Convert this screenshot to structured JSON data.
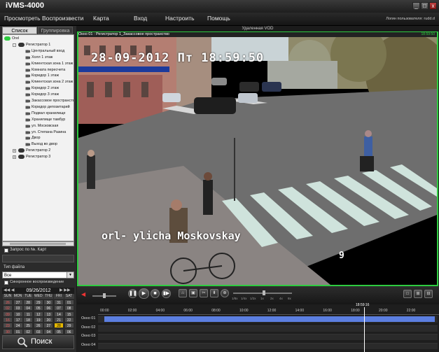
{
  "app": {
    "title": "iVMS-4000"
  },
  "window_buttons": {
    "minimize": "_",
    "maximize": "□",
    "close": "x"
  },
  "menu": [
    "Просмотреть",
    "Воспроизвести",
    "Карта",
    "Вход",
    "Настроить",
    "Помощь"
  ],
  "user_info": "Логин пользователя: rudd.d",
  "left": {
    "tabs": [
      "Список",
      "Группировка"
    ],
    "tree": [
      {
        "label": "Orel",
        "level": 0,
        "type": "root"
      },
      {
        "label": "Регистратор 1",
        "level": 1,
        "type": "node",
        "expanded": true
      },
      {
        "label": "Центральный вход",
        "level": 2,
        "type": "camera"
      },
      {
        "label": "Холл 1 этаж",
        "level": 2,
        "type": "camera"
      },
      {
        "label": "Клиентская зона 1 этаж",
        "level": 2,
        "type": "camera"
      },
      {
        "label": "Комната пересчета",
        "level": 2,
        "type": "camera"
      },
      {
        "label": "Коридор 1 этаж",
        "level": 2,
        "type": "camera"
      },
      {
        "label": "Клиентская зона 2 этаж",
        "level": 2,
        "type": "camera"
      },
      {
        "label": "Коридор 2 этаж",
        "level": 2,
        "type": "camera"
      },
      {
        "label": "Коридор 3 этаж",
        "level": 2,
        "type": "camera"
      },
      {
        "label": "Закассовое пространство",
        "level": 2,
        "type": "camera"
      },
      {
        "label": "Коридор депозитарий",
        "level": 2,
        "type": "camera"
      },
      {
        "label": "Подвал хранилище",
        "level": 2,
        "type": "camera"
      },
      {
        "label": "Хранилище тамбур",
        "level": 2,
        "type": "camera"
      },
      {
        "label": "ул. Московская",
        "level": 2,
        "type": "camera"
      },
      {
        "label": "ул. Степана Разина",
        "level": 2,
        "type": "camera"
      },
      {
        "label": "Двор",
        "level": 2,
        "type": "camera"
      },
      {
        "label": "Выход во двор",
        "level": 2,
        "type": "camera"
      },
      {
        "label": "Регистратор 2",
        "level": 1,
        "type": "node",
        "expanded": false
      },
      {
        "label": "Регистратор 3",
        "level": 1,
        "type": "node",
        "expanded": false
      }
    ],
    "card_search_label": "Запрос по №. Карт",
    "file_type_label": "Тип файла",
    "file_type_value": "Все",
    "sync_label": "Синхронное воспроизведение",
    "calendar": {
      "title": "09/26/2012",
      "prev": "◀◀ ◀",
      "next": "▶ ▶▶",
      "dow": [
        "SUN",
        "MON",
        "TUE",
        "WED",
        "THU",
        "FRI",
        "SAT"
      ],
      "weeks": [
        [
          "26",
          "27",
          "28",
          "29",
          "30",
          "31",
          "01"
        ],
        [
          "02",
          "03",
          "04",
          "05",
          "06",
          "07",
          "08"
        ],
        [
          "09",
          "10",
          "11",
          "12",
          "13",
          "14",
          "15"
        ],
        [
          "16",
          "17",
          "18",
          "19",
          "20",
          "21",
          "22"
        ],
        [
          "23",
          "24",
          "25",
          "26",
          "27",
          "28",
          "29"
        ],
        [
          "30",
          "01",
          "02",
          "03",
          "04",
          "05",
          "06"
        ]
      ],
      "selected": "28"
    },
    "search_label": "Поиск"
  },
  "video": {
    "header": "Удаленная VOD",
    "window_title": "Окно 01 : Регистратор 1_Закассовое пространство",
    "top_right_time": "18:59:50",
    "osd_date": "28-09-2012 Пт 18:59:50",
    "osd_street": "orl- ylicha Moskovskay",
    "osd_number": "9"
  },
  "controls": {
    "volume_icon": "◀",
    "buttons": [
      "❚❚",
      "▶",
      "■",
      "▮▶"
    ],
    "tools": [
      "⌂",
      "▣",
      "✂",
      "⬇",
      "⊕"
    ],
    "speeds": [
      "1/8x",
      "1/4x",
      "1/2x",
      "1x",
      "2x",
      "4x",
      "8x"
    ],
    "layout_buttons": [
      "□",
      "⊞",
      "⊟"
    ],
    "volume_level": 0.45,
    "speed_level": 0.5
  },
  "timeline": {
    "cursor_time": "18:59:16",
    "ticks": [
      "00:00",
      "02:00",
      "04:00",
      "06:00",
      "08:00",
      "10:00",
      "12:00",
      "14:00",
      "16:00",
      "18:00",
      "20:00",
      "22:00"
    ],
    "tracks": [
      "Окно 01",
      "Окно 02",
      "Окно 03",
      "Окно 04"
    ]
  },
  "colors": {
    "accent_green": "#2ecc40",
    "record_blue": "#5c7fe0",
    "selected_day": "#e6b800"
  }
}
